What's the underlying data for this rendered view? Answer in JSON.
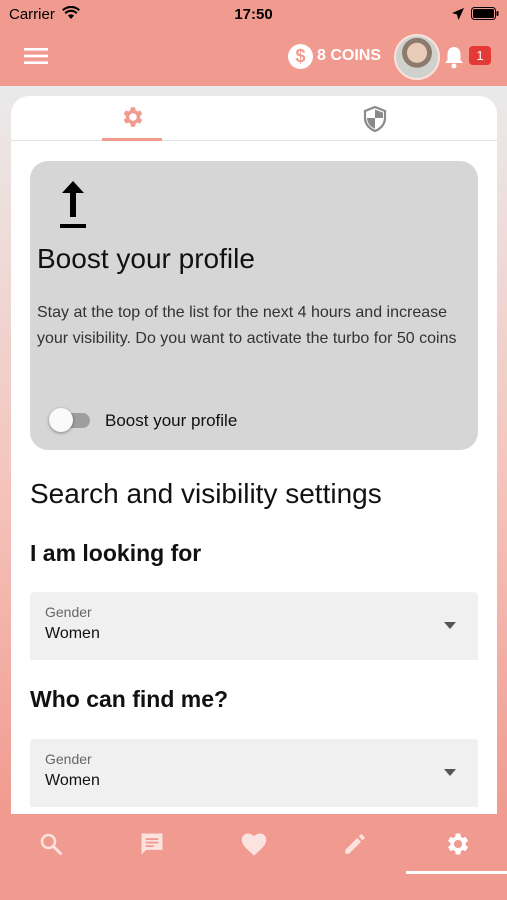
{
  "status_bar": {
    "carrier": "Carrier",
    "time": "17:50"
  },
  "header": {
    "coins_symbol": "$",
    "coins_label": "8 COINS",
    "notification_count": "1"
  },
  "tabs": [
    {
      "name": "settings",
      "icon": "gear-icon",
      "active": true
    },
    {
      "name": "privacy",
      "icon": "shield-icon",
      "active": false
    }
  ],
  "boost": {
    "title": "Boost your profile",
    "description": "Stay at the top of the list for the next 4 hours and increase your visibility. Do you want to activate the turbo for 50 coins",
    "toggle_label": "Boost your profile",
    "toggle_on": false
  },
  "settings": {
    "section_title": "Search and visibility settings",
    "looking_for": {
      "title": "I am looking for",
      "field_label": "Gender",
      "value": "Women"
    },
    "who_can_find": {
      "title": "Who can find me?",
      "field_label": "Gender",
      "value": "Women"
    }
  },
  "bottom_nav": [
    {
      "name": "search",
      "icon": "search-icon"
    },
    {
      "name": "messages",
      "icon": "chat-icon"
    },
    {
      "name": "favorites",
      "icon": "heart-icon"
    },
    {
      "name": "edit",
      "icon": "pencil-icon"
    },
    {
      "name": "settings",
      "icon": "gear-icon",
      "active": true
    }
  ],
  "colors": {
    "accent": "#f19a8f",
    "card_gray": "#d6d6d6",
    "badge": "#e53935"
  }
}
